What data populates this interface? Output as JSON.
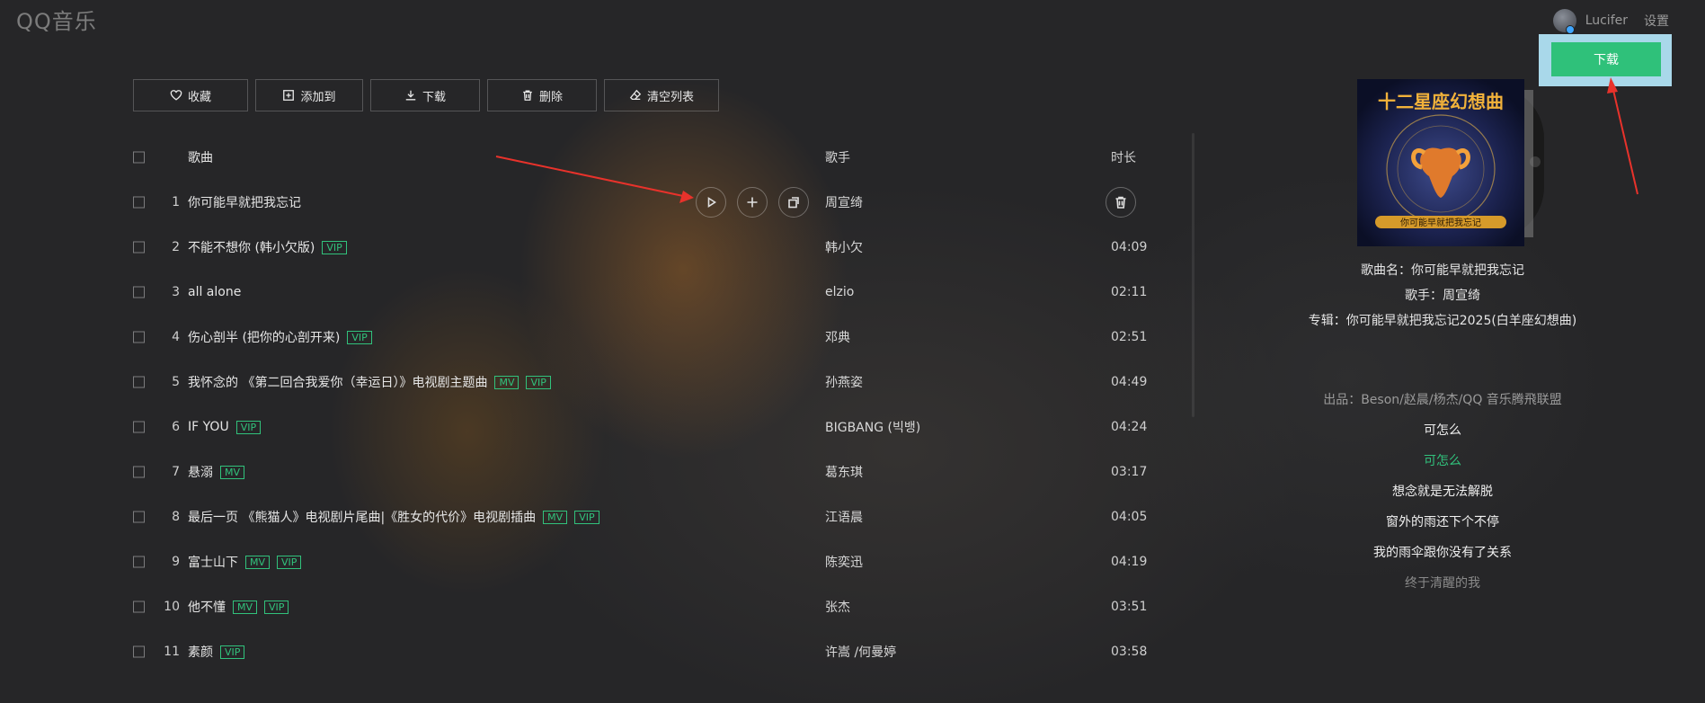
{
  "app": {
    "logo": "QQ音乐"
  },
  "user": {
    "name": "Lucifer",
    "settings_label": "设置"
  },
  "toolbar": [
    {
      "label": "收藏",
      "icon": "heart-icon"
    },
    {
      "label": "添加到",
      "icon": "add-box-icon"
    },
    {
      "label": "下载",
      "icon": "download-icon"
    },
    {
      "label": "删除",
      "icon": "trash-icon"
    },
    {
      "label": "清空列表",
      "icon": "eraser-icon"
    }
  ],
  "columns": {
    "song": "歌曲",
    "singer": "歌手",
    "duration": "时长"
  },
  "songs": [
    {
      "num": "1",
      "title": "你可能早就把我忘记",
      "badges": [],
      "singer": "周宣绮",
      "duration": ""
    },
    {
      "num": "2",
      "title": "不能不想你 (韩小欠版)",
      "badges": [
        "VIP"
      ],
      "singer": "韩小欠",
      "duration": "04:09"
    },
    {
      "num": "3",
      "title": "all alone",
      "badges": [],
      "singer": "elzio",
      "duration": "02:11"
    },
    {
      "num": "4",
      "title": "伤心剖半 (把你的心剖开来)",
      "badges": [
        "VIP"
      ],
      "singer": "邓典",
      "duration": "02:51"
    },
    {
      "num": "5",
      "title": "我怀念的 《第二回合我爱你（幸运日）》电视剧主题曲",
      "badges": [
        "MV",
        "VIP"
      ],
      "singer": "孙燕姿",
      "duration": "04:49"
    },
    {
      "num": "6",
      "title": "IF YOU",
      "badges": [
        "VIP"
      ],
      "singer": "BIGBANG (빅뱅)",
      "duration": "04:24"
    },
    {
      "num": "7",
      "title": "悬溺",
      "badges": [
        "MV"
      ],
      "singer": "葛东琪",
      "duration": "03:17"
    },
    {
      "num": "8",
      "title": "最后一页 《熊猫人》电视剧片尾曲|《胜女的代价》电视剧插曲",
      "badges": [
        "MV",
        "VIP"
      ],
      "singer": "江语晨",
      "duration": "04:05"
    },
    {
      "num": "9",
      "title": "富士山下",
      "badges": [
        "MV",
        "VIP"
      ],
      "singer": "陈奕迅",
      "duration": "04:19"
    },
    {
      "num": "10",
      "title": "他不懂",
      "badges": [
        "MV",
        "VIP"
      ],
      "singer": "张杰",
      "duration": "03:51"
    },
    {
      "num": "11",
      "title": "素颜",
      "badges": [
        "VIP"
      ],
      "singer": "许嵩 /何曼婷",
      "duration": "03:58"
    }
  ],
  "row_actions": [
    "play-icon",
    "add-icon",
    "share-icon",
    "delete-icon"
  ],
  "now_playing": {
    "album_art_text": "十二星座幻想曲",
    "album_art_subtext": "你可能早就把我忘记",
    "song_line": "歌曲名：你可能早就把我忘记",
    "singer_line": "歌手：周宣绮",
    "album_line": "专辑：你可能早就把我忘记2025(白羊座幻想曲)"
  },
  "lyrics": [
    {
      "text": "出品：Beson/赵晨/杨杰/QQ 音乐腾飛联盟",
      "style": "dim"
    },
    {
      "text": "可怎么",
      "style": "normal"
    },
    {
      "text": "可怎么",
      "style": "active"
    },
    {
      "text": "想念就是无法解脱",
      "style": "normal"
    },
    {
      "text": "窗外的雨还下个不停",
      "style": "normal"
    },
    {
      "text": "我的雨伞跟你没有了关系",
      "style": "normal"
    },
    {
      "text": "终于清醒的我",
      "style": "faded"
    }
  ],
  "download_popup": {
    "label": "下载"
  },
  "colors": {
    "accent": "#31c27c",
    "popup_bg": "#a9d8ea",
    "arrow": "#e8322b"
  }
}
